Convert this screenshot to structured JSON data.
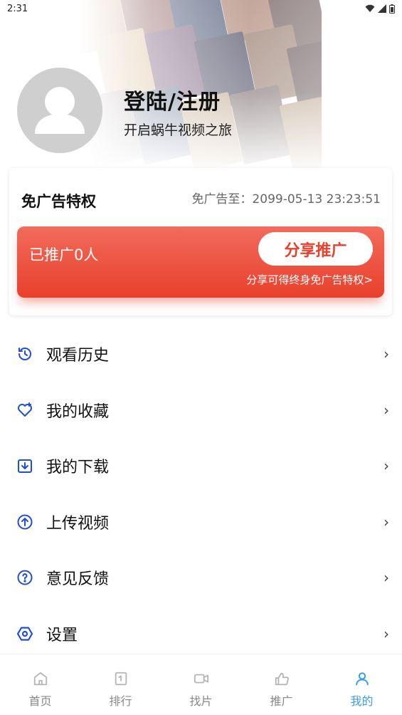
{
  "status_bar": {
    "time": "2:31"
  },
  "profile": {
    "login_title": "登陆/注册",
    "subtitle": "开启蜗牛视频之旅"
  },
  "ad_free": {
    "title": "免广告特权",
    "expire": "免广告至：2099-05-13 23:23:51",
    "promoted_count": "已推广0人",
    "share_button": "分享推广",
    "share_tip": "分享可得终身免广告特权>"
  },
  "menu": [
    {
      "label": "观看历史",
      "icon": "history-icon"
    },
    {
      "label": "我的收藏",
      "icon": "favorite-icon"
    },
    {
      "label": "我的下载",
      "icon": "download-icon"
    },
    {
      "label": "上传视频",
      "icon": "upload-icon"
    },
    {
      "label": "意见反馈",
      "icon": "feedback-icon"
    },
    {
      "label": "设置",
      "icon": "settings-icon"
    }
  ],
  "menu_arrow": "›",
  "bottom_nav": [
    {
      "label": "首页",
      "icon": "home-icon",
      "active": false
    },
    {
      "label": "排行",
      "icon": "ranking-icon",
      "active": false
    },
    {
      "label": "找片",
      "icon": "video-search-icon",
      "active": false
    },
    {
      "label": "推广",
      "icon": "promote-icon",
      "active": false
    },
    {
      "label": "我的",
      "icon": "profile-icon",
      "active": true
    }
  ],
  "colors": {
    "accent_red": "#e8402c",
    "menu_icon_blue": "#1f4fd8",
    "nav_active": "#3a9cf0",
    "nav_inactive": "#9a9a9a"
  }
}
